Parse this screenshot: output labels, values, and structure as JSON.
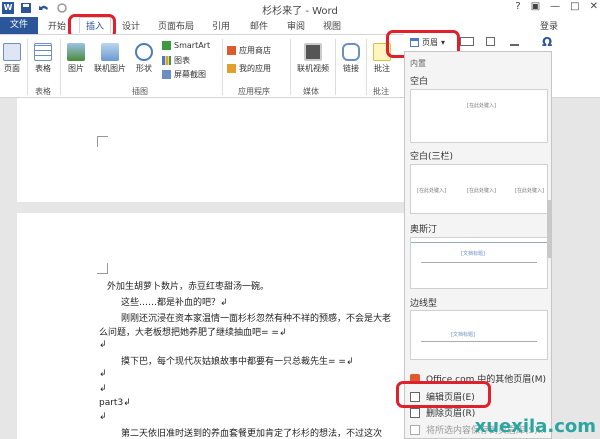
{
  "titlebar": {
    "title": "杉杉来了 - Word",
    "word_glyph": "W",
    "window_controls": [
      "?",
      "▣",
      "—",
      "□",
      "✕"
    ]
  },
  "tabs": {
    "file": "文件",
    "items": [
      "开始",
      "插入",
      "设计",
      "页面布局",
      "引用",
      "邮件",
      "审阅",
      "视图"
    ],
    "active": "插入",
    "login": "登录"
  },
  "ribbon": {
    "buttons": {
      "cover": "页面",
      "table": "表格",
      "picture": "图片",
      "online_picture": "联机图片",
      "shapes": "形状",
      "smartart": "SmartArt",
      "chart": "图表",
      "screenshot": "屏幕截图",
      "store": "应用商店",
      "my_apps": "我的应用",
      "online_video": "联机视频",
      "link": "链接",
      "comment": "批注",
      "header": "页眉",
      "symbol_glyph": "Ω"
    },
    "groups": {
      "tables": "表格",
      "illustrations": "插图",
      "apps": "应用程序",
      "media": "媒体",
      "comments": "批注"
    }
  },
  "header_gallery": {
    "section": "内置",
    "items": [
      {
        "name": "空白",
        "placeholders": [
          "[在此处键入]"
        ]
      },
      {
        "name": "空白(三栏)",
        "placeholders": [
          "[在此处键入]",
          "[在此处键入]",
          "[在此处键入]"
        ]
      },
      {
        "name": "奥斯汀",
        "placeholders": [
          "[文档标题]"
        ]
      },
      {
        "name": "边线型",
        "placeholders": [
          "[文档标题]"
        ]
      }
    ],
    "menu": [
      {
        "label": "Office.com 中的其他页眉(M)",
        "icon": "office-icon"
      },
      {
        "label": "编辑页眉(E)",
        "icon": "edit-header-icon"
      },
      {
        "label": "删除页眉(R)",
        "icon": "delete-header-icon"
      },
      {
        "label": "将所选内容保存到页眉库(S)...",
        "icon": "save-to-gallery-icon"
      }
    ]
  },
  "document": {
    "lines": [
      "外加生胡萝卜数片，赤豆红枣甜汤一碗。",
      "这些……都是补血的吧？↲",
      "刚刚还沉浸在资本家温情一面杉杉忽然有种不祥的预感，不会是大老",
      "么问题，大老板想把她养肥了继续抽血吧= =↲",
      "↲",
      "摸下巴，每个现代灰姑娘故事中都要有一只总裁先生= =↲",
      "↲",
      "↲",
      "part3↲",
      "↲",
      "第二天依旧准时送到的养血套餐更加肯定了杉杉的想法，不过这次"
    ]
  },
  "watermark": "xuexila.com",
  "colors": {
    "accent": "#2b579a",
    "highlight": "#e0202b",
    "watermark": "#2aa5a0"
  }
}
